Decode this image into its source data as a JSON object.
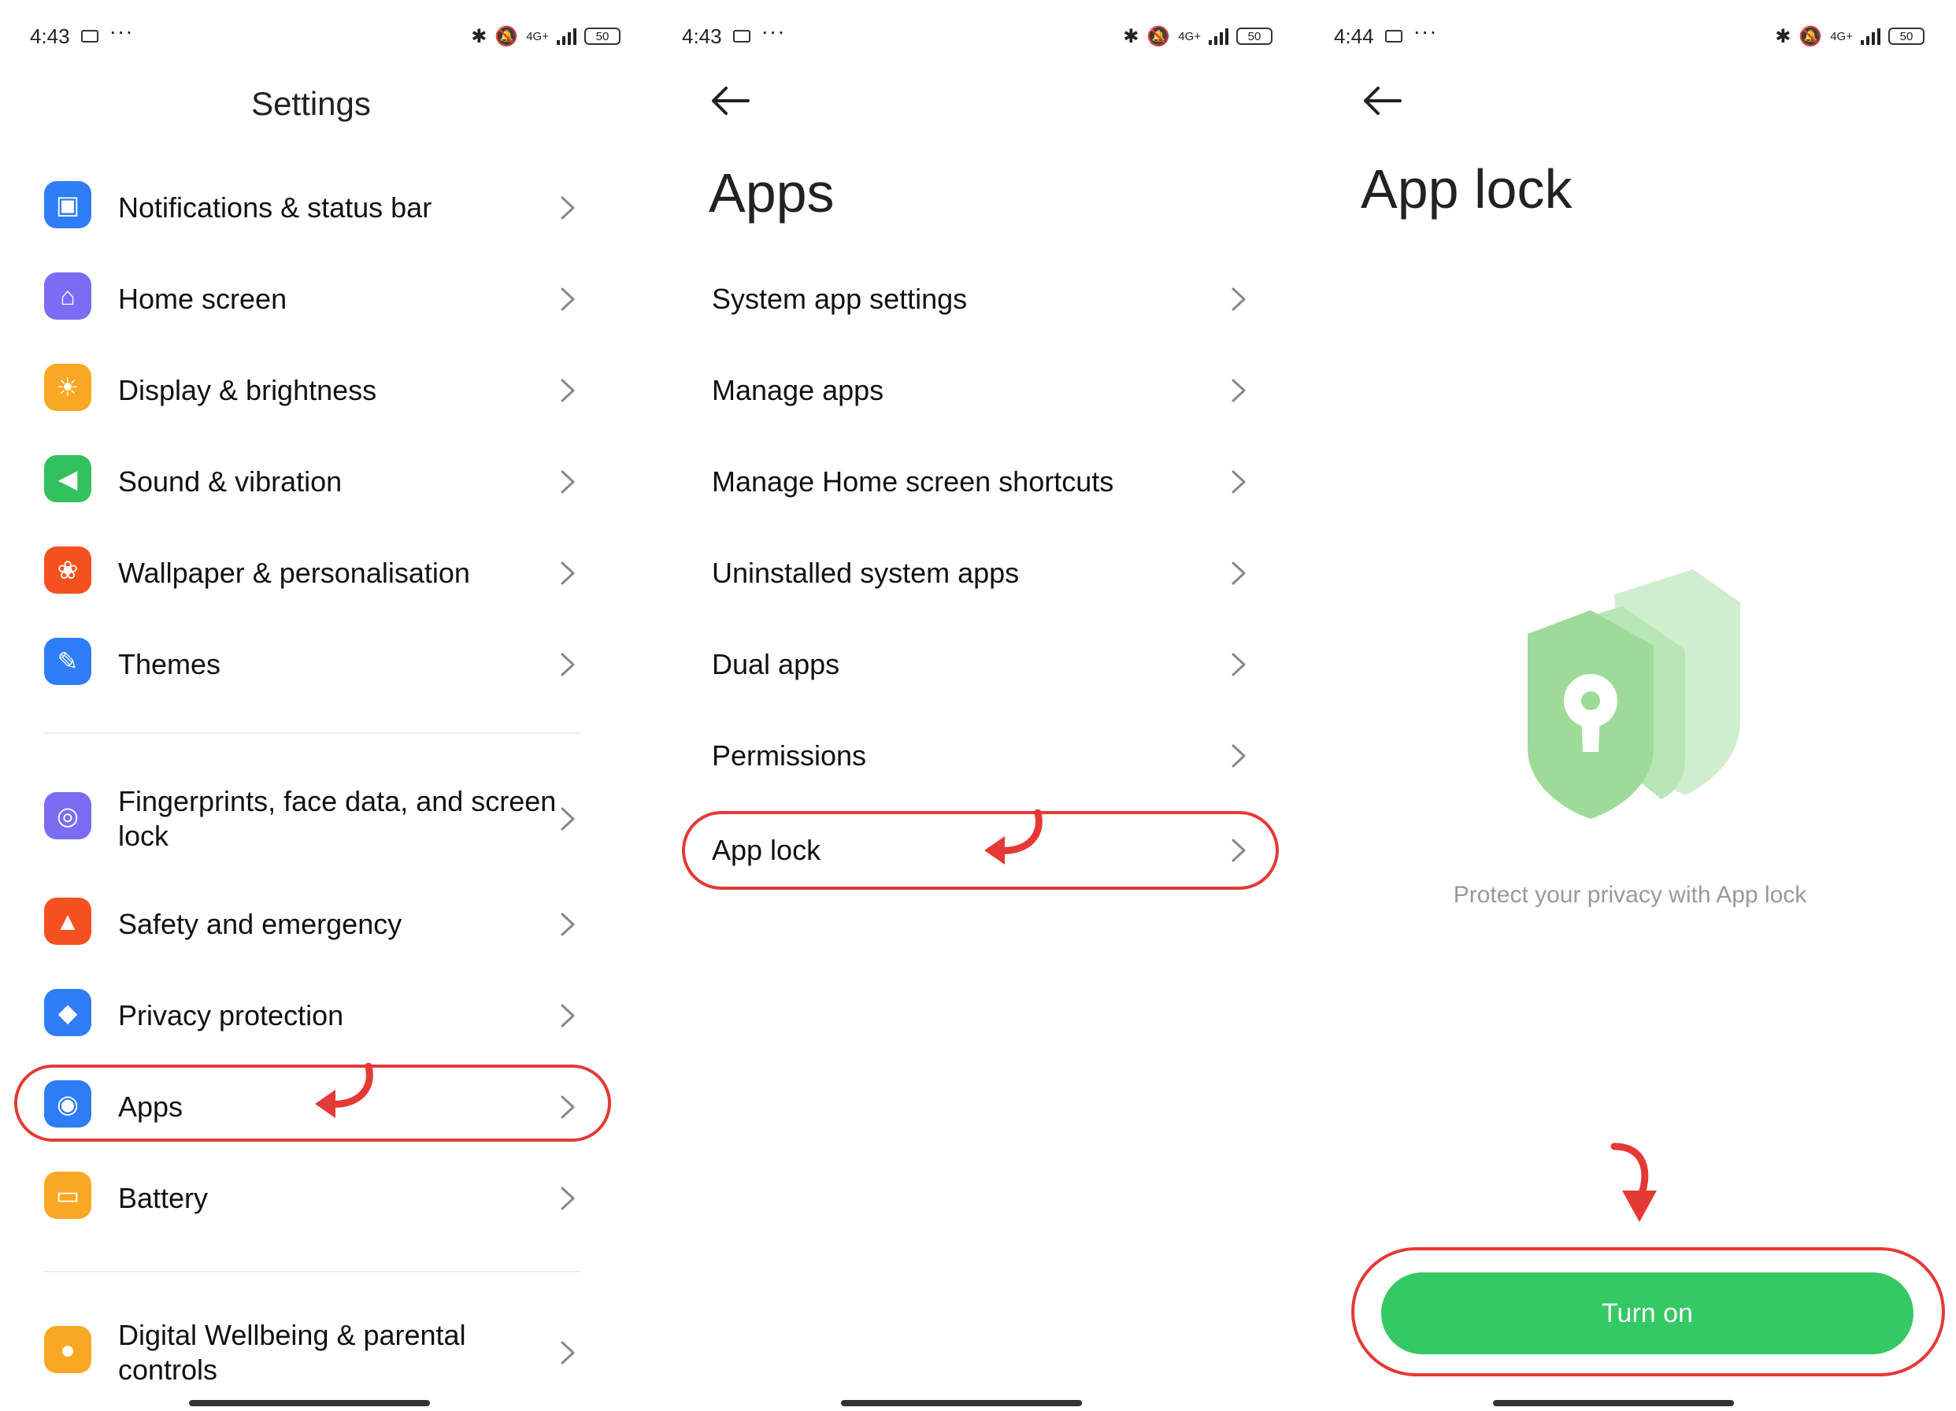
{
  "status_bars": [
    {
      "time": "4:43",
      "battery": "50",
      "network": "4G+"
    },
    {
      "time": "4:43",
      "battery": "50",
      "network": "4G+"
    },
    {
      "time": "4:44",
      "battery": "50",
      "network": "4G+"
    }
  ],
  "settings_screen": {
    "title": "Settings",
    "group1": [
      {
        "label": "Notifications & status bar",
        "icon": "notifications-icon",
        "color": "#2f7df6"
      },
      {
        "label": "Home screen",
        "icon": "home-icon",
        "color": "#7c6cf4"
      },
      {
        "label": "Display & brightness",
        "icon": "sun-icon",
        "color": "#f9a825"
      },
      {
        "label": "Sound & vibration",
        "icon": "speaker-icon",
        "color": "#33c15d"
      },
      {
        "label": "Wallpaper & personalisation",
        "icon": "wallpaper-icon",
        "color": "#f4511e"
      },
      {
        "label": "Themes",
        "icon": "brush-icon",
        "color": "#2f7df6"
      }
    ],
    "group2": [
      {
        "label": "Fingerprints, face data, and screen lock",
        "icon": "fingerprint-icon",
        "color": "#7c6cf4"
      },
      {
        "label": "Safety and emergency",
        "icon": "alarm-icon",
        "color": "#f4511e"
      },
      {
        "label": "Privacy protection",
        "icon": "shield-icon",
        "color": "#2f7df6"
      },
      {
        "label": "Apps",
        "icon": "apps-icon",
        "color": "#2f7df6"
      },
      {
        "label": "Battery",
        "icon": "battery-icon",
        "color": "#f9a825"
      }
    ],
    "group3": [
      {
        "label": "Digital Wellbeing & parental controls",
        "icon": "wellbeing-icon",
        "color": "#f9a825"
      }
    ]
  },
  "apps_screen": {
    "title": "Apps",
    "items": [
      {
        "label": "System app settings"
      },
      {
        "label": "Manage apps"
      },
      {
        "label": "Manage Home screen shortcuts"
      },
      {
        "label": "Uninstalled system apps"
      },
      {
        "label": "Dual apps"
      },
      {
        "label": "Permissions"
      },
      {
        "label": "App lock"
      }
    ]
  },
  "applock_screen": {
    "title": "App lock",
    "hint": "Protect your privacy with App lock",
    "button": "Turn on"
  },
  "colors": {
    "highlight": "#e53935",
    "turn_on": "#34c964"
  }
}
